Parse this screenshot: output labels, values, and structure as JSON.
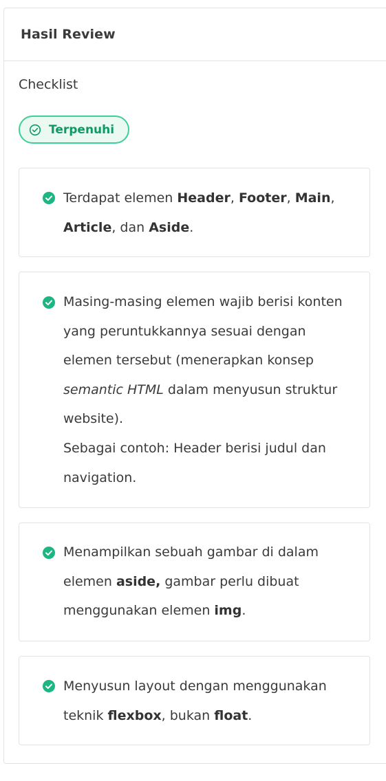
{
  "panel": {
    "title": "Hasil Review"
  },
  "checklist": {
    "label": "Checklist",
    "status_badge": "Terpenuhi",
    "colors": {
      "badge_border": "#3ccf96",
      "badge_bg": "#eafaf3",
      "badge_text": "#0d9a63",
      "check": "#1db682"
    }
  },
  "items": [
    {
      "lines": [
        [
          {
            "t": "Terdapat elemen "
          },
          {
            "t": "Header",
            "b": true
          },
          {
            "t": ", "
          },
          {
            "t": "Footer",
            "b": true
          },
          {
            "t": ", "
          },
          {
            "t": "Main",
            "b": true
          },
          {
            "t": ","
          }
        ],
        [
          {
            "t": "Article",
            "b": true
          },
          {
            "t": ", dan "
          },
          {
            "t": "Aside",
            "b": true
          },
          {
            "t": "."
          }
        ]
      ]
    },
    {
      "lines": [
        [
          {
            "t": "Masing-masing elemen wajib berisi konten"
          }
        ],
        [
          {
            "t": "yang peruntukkannya sesuai dengan"
          }
        ],
        [
          {
            "t": "elemen tersebut (menerapkan konsep"
          }
        ],
        [
          {
            "t": "semantic HTML",
            "i": true
          },
          {
            "t": " dalam menyusun struktur"
          }
        ],
        [
          {
            "t": "website)."
          }
        ],
        [
          {
            "t": "Sebagai contoh: Header berisi judul dan"
          }
        ],
        [
          {
            "t": "navigation."
          }
        ]
      ]
    },
    {
      "lines": [
        [
          {
            "t": "Menampilkan sebuah gambar di dalam"
          }
        ],
        [
          {
            "t": "elemen "
          },
          {
            "t": "aside,",
            "b": true
          },
          {
            "t": " gambar perlu dibuat"
          }
        ],
        [
          {
            "t": "menggunakan elemen "
          },
          {
            "t": "img",
            "b": true
          },
          {
            "t": "."
          }
        ]
      ]
    },
    {
      "lines": [
        [
          {
            "t": "Menyusun layout dengan menggunakan"
          }
        ],
        [
          {
            "t": "teknik "
          },
          {
            "t": "flexbox",
            "b": true
          },
          {
            "t": ", bukan "
          },
          {
            "t": "float",
            "b": true
          },
          {
            "t": "."
          }
        ]
      ]
    }
  ]
}
